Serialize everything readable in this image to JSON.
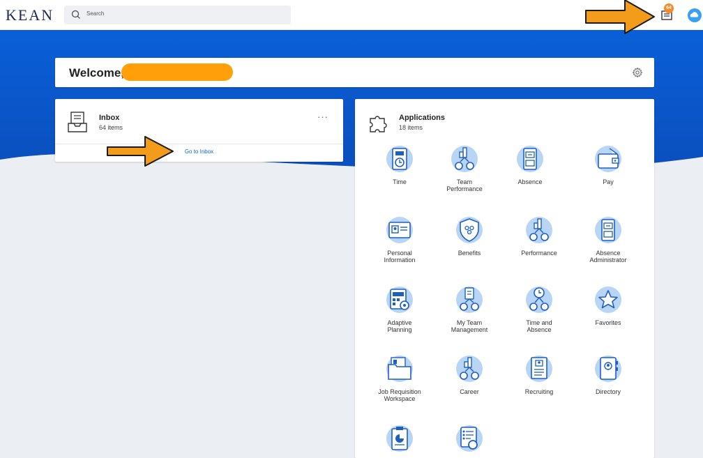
{
  "header": {
    "logo": "KEAN",
    "search_placeholder": "Search",
    "notification_count": "64"
  },
  "welcome": {
    "text": "Welcome,"
  },
  "inbox": {
    "title": "Inbox",
    "count": "64 items",
    "more": "···",
    "link": "Go to Inbox"
  },
  "applications": {
    "title": "Applications",
    "count": "18 items",
    "items": [
      {
        "label": "Time",
        "icon": "time-clock-icon"
      },
      {
        "label": "Team\nPerformance",
        "icon": "team-performance-icon"
      },
      {
        "label": "Absence",
        "icon": "absence-cabinet-icon"
      },
      {
        "label": "Pay",
        "icon": "pay-wallet-icon"
      },
      {
        "label": "Personal\nInformation",
        "icon": "personal-id-card-icon"
      },
      {
        "label": "Benefits",
        "icon": "benefits-shield-icon"
      },
      {
        "label": "Performance",
        "icon": "performance-chart-icon"
      },
      {
        "label": "Absence\nAdministrator",
        "icon": "absence-administrator-icon"
      },
      {
        "label": "Adaptive\nPlanning",
        "icon": "adaptive-planning-icon"
      },
      {
        "label": "My Team\nManagement",
        "icon": "my-team-management-icon"
      },
      {
        "label": "Time and\nAbsence",
        "icon": "time-and-absence-icon"
      },
      {
        "label": "Favorites",
        "icon": "star-icon"
      },
      {
        "label": "Job Requisition\nWorkspace",
        "icon": "job-requisition-icon"
      },
      {
        "label": "Career",
        "icon": "career-chart-icon"
      },
      {
        "label": "Recruiting",
        "icon": "recruiting-resume-icon"
      },
      {
        "label": "Directory",
        "icon": "directory-book-icon"
      },
      {
        "label": "",
        "icon": "clipboard-report-icon"
      },
      {
        "label": "",
        "icon": "checklist-search-icon"
      }
    ]
  },
  "colors": {
    "brand_blue": "#0a5dd6",
    "accent_orange": "#ff9f0a",
    "icon_blue": "#1f5fbf",
    "icon_light": "#b9d5f5"
  }
}
